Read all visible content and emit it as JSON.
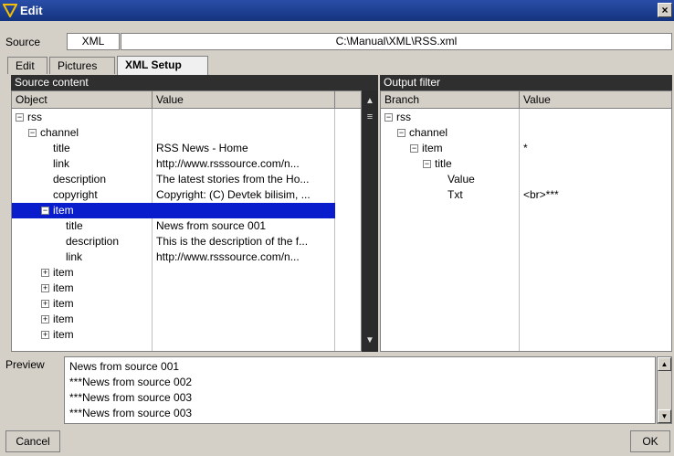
{
  "window": {
    "title": "Edit",
    "close_symbol": "×"
  },
  "source": {
    "label": "Source",
    "type_button": "XML",
    "path": "C:\\Manual\\XML\\RSS.xml"
  },
  "tabs": [
    {
      "label": "Edit"
    },
    {
      "label": "Pictures"
    },
    {
      "label": "XML Setup"
    }
  ],
  "active_tab": "XML Setup",
  "source_content": {
    "header": "Source content",
    "columns": {
      "object": "Object",
      "value": "Value"
    },
    "rows": [
      {
        "name": "rss",
        "value": "",
        "expander": "minus",
        "depth": 0
      },
      {
        "name": "channel",
        "value": "",
        "expander": "minus",
        "depth": 1
      },
      {
        "name": "title",
        "value": "RSS News - Home",
        "expander": "",
        "depth": 2
      },
      {
        "name": "link",
        "value": "http://www.rsssource.com/n...",
        "expander": "",
        "depth": 2
      },
      {
        "name": "description",
        "value": "The latest stories from the Ho...",
        "expander": "",
        "depth": 2
      },
      {
        "name": "copyright",
        "value": "Copyright: (C) Devtek bilisim, ...",
        "expander": "",
        "depth": 2
      },
      {
        "name": "item",
        "value": "",
        "expander": "minus",
        "depth": 2,
        "selected": true
      },
      {
        "name": "title",
        "value": "News from source 001",
        "expander": "",
        "depth": 3
      },
      {
        "name": "description",
        "value": "This is the description of the f...",
        "expander": "",
        "depth": 3
      },
      {
        "name": "link",
        "value": "http://www.rsssource.com/n...",
        "expander": "",
        "depth": 3
      },
      {
        "name": "item",
        "value": "",
        "expander": "plus",
        "depth": 2
      },
      {
        "name": "item",
        "value": "",
        "expander": "plus",
        "depth": 2
      },
      {
        "name": "item",
        "value": "",
        "expander": "plus",
        "depth": 2
      },
      {
        "name": "item",
        "value": "",
        "expander": "plus",
        "depth": 2
      },
      {
        "name": "item",
        "value": "",
        "expander": "plus",
        "depth": 2
      }
    ]
  },
  "output_filter": {
    "header": "Output filter",
    "columns": {
      "branch": "Branch",
      "value": "Value"
    },
    "rows": [
      {
        "name": "rss",
        "value": "",
        "expander": "minus",
        "depth": 0
      },
      {
        "name": "channel",
        "value": "",
        "expander": "minus",
        "depth": 1
      },
      {
        "name": "item",
        "value": "*",
        "expander": "minus",
        "depth": 2
      },
      {
        "name": "title",
        "value": "",
        "expander": "minus",
        "depth": 3
      },
      {
        "name": "Value",
        "value": "",
        "expander": "",
        "depth": 4
      },
      {
        "name": "Txt",
        "value": "<br>***",
        "expander": "",
        "depth": 4
      }
    ]
  },
  "scrollbar": {
    "up": "▲",
    "down": "▼",
    "thumb": "≡"
  },
  "preview": {
    "label": "Preview",
    "lines": [
      "News from source 001",
      "***News from source 002",
      "***News from source 003",
      "***News from source 003"
    ]
  },
  "buttons": {
    "cancel": "Cancel",
    "ok": "OK"
  },
  "colors": {
    "title_bar": "#1a3b8f",
    "selection": "#0a1dcc",
    "panel_header": "#2f2f2f"
  }
}
